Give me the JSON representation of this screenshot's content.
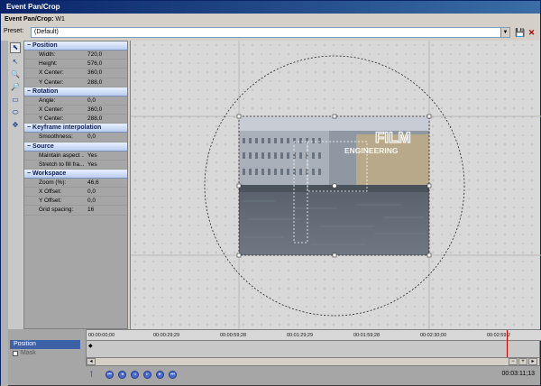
{
  "window": {
    "title": "Event Pan/Crop"
  },
  "header": {
    "label": "Event Pan/Crop:",
    "event_name": "W1"
  },
  "preset": {
    "label": "Preset:",
    "value": "(Default)"
  },
  "tools": [
    "pointer-icon",
    "zoom-icon",
    "zoom-out-icon",
    "view-icon",
    "ellipse-icon",
    "move-icon",
    "snap-icon"
  ],
  "properties": {
    "position": {
      "title": "Position",
      "rows": [
        {
          "key": "Width:",
          "value": "720,0"
        },
        {
          "key": "Height:",
          "value": "576,0"
        },
        {
          "key": "X Center:",
          "value": "360,0"
        },
        {
          "key": "Y Center:",
          "value": "288,0"
        }
      ]
    },
    "rotation": {
      "title": "Rotation",
      "rows": [
        {
          "key": "Angle:",
          "value": "0,0"
        },
        {
          "key": "X Center:",
          "value": "360,0"
        },
        {
          "key": "Y Center:",
          "value": "288,0"
        }
      ]
    },
    "keyframe": {
      "title": "Keyframe interpolation",
      "rows": [
        {
          "key": "Smoothness:",
          "value": "0,0"
        }
      ]
    },
    "source": {
      "title": "Source",
      "rows": [
        {
          "key": "Maintain aspect ...",
          "value": "Yes"
        },
        {
          "key": "Stretch to fill fra...",
          "value": "Yes"
        }
      ]
    },
    "workspace": {
      "title": "Workspace",
      "rows": [
        {
          "key": "Zoom (%):",
          "value": "46,6"
        },
        {
          "key": "X Offset:",
          "value": "0,0"
        },
        {
          "key": "Y Offset:",
          "value": "0,0"
        },
        {
          "key": "Grid spacing:",
          "value": "16"
        }
      ]
    }
  },
  "preview": {
    "watermark_line1": "FILM",
    "watermark_line2": "ENGINEERING"
  },
  "timeline": {
    "track_label": "Position",
    "mask_label": "Mask",
    "ticks": [
      "00:00:00;00",
      "00:00:29;29",
      "00:00:59;28",
      "00:01:29;29",
      "00:01:59;28",
      "00:02:30;00",
      "00:02:59;2"
    ],
    "timecode": "00:03:11;13"
  }
}
